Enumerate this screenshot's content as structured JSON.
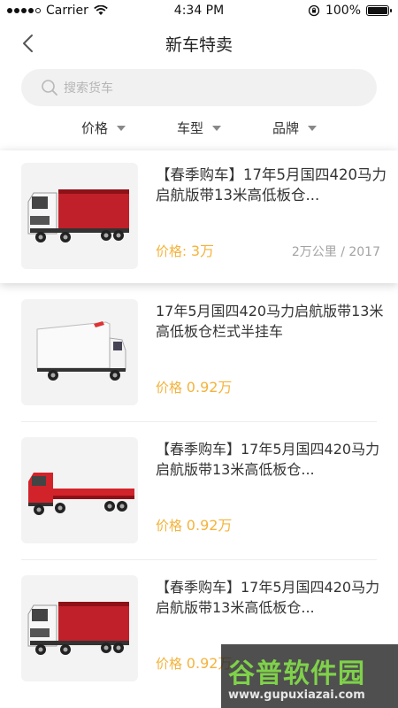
{
  "status_bar": {
    "carrier": "Carrier",
    "time": "4:34 PM",
    "battery": "100%"
  },
  "nav": {
    "title": "新车特卖"
  },
  "search": {
    "placeholder": "搜索货车"
  },
  "filters": [
    "价格",
    "车型",
    "品牌"
  ],
  "listings": [
    {
      "title": "【春季购车】17年5月国四420马力启航版带13米高低板仓...",
      "price_label": "价格:",
      "price_value": "3万",
      "mileage_year": "2万公里 / 2017",
      "truck": "red-box-truck"
    },
    {
      "title": "17年5月国四420马力启航版带13米高低板仓栏式半挂车",
      "price_label": "价格",
      "price_value": "0.92万",
      "truck": "white-light-truck"
    },
    {
      "title": "【春季购车】17年5月国四420马力启航版带13米高低板仓...",
      "price_label": "价格",
      "price_value": "0.92万",
      "truck": "red-flatbed-truck"
    },
    {
      "title": "【春季购车】17年5月国四420马力启航版带13米高低板仓...",
      "price_label": "价格",
      "price_value": "0.92万",
      "truck": "red-box-truck"
    }
  ],
  "watermark": {
    "title": "谷普软件园",
    "url": "www.gupuxiazai.com"
  }
}
